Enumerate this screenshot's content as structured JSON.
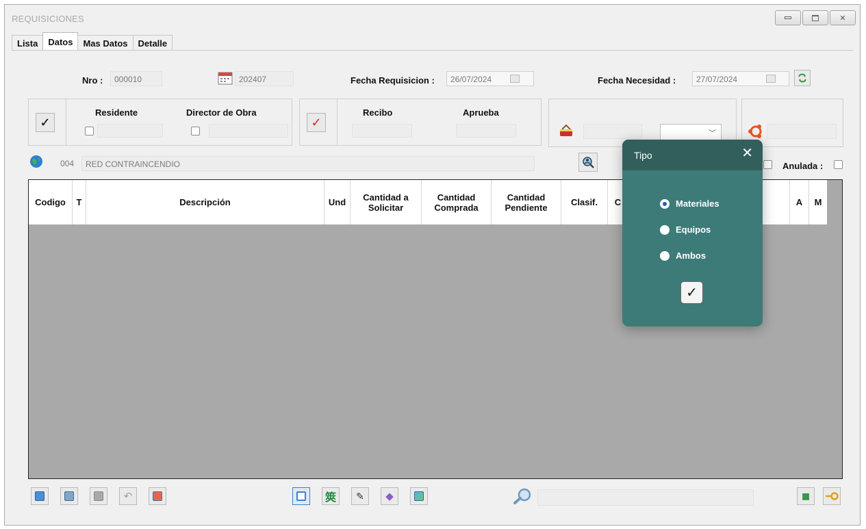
{
  "window": {
    "title": "REQUISICIONES",
    "controls": [
      "minimize",
      "maximize",
      "close"
    ]
  },
  "tabs": [
    {
      "label": "Lista",
      "active": false
    },
    {
      "label": "Datos",
      "active": true
    },
    {
      "label": "Mas Datos",
      "active": false
    },
    {
      "label": "Detalle",
      "active": false
    }
  ],
  "header": {
    "nro_label": "Nro :",
    "nro_value": "000010",
    "period_value": "202407",
    "fecha_requisicion_label": "Fecha Requisicion :",
    "fecha_requisicion_value": "26/07/2024",
    "fecha_necesidad_label": "Fecha Necesidad :",
    "fecha_necesidad_value": "27/07/2024"
  },
  "approvals": {
    "residente_label": "Residente",
    "director_label": "Director de Obra",
    "recibo_label": "Recibo",
    "aprueba_label": "Aprueba"
  },
  "project": {
    "code": "004",
    "name": "RED CONTRAINCENDIO",
    "anulada_label": "Anulada :"
  },
  "grid": {
    "columns": [
      "Codigo",
      "T",
      "Descripción",
      "Und",
      "Cantidad a Solicitar",
      "Cantidad Comprada",
      "Cantidad Pendiente",
      "Clasif.",
      "C",
      "",
      "A",
      "M"
    ],
    "rows": []
  },
  "dialog": {
    "title": "Tipo",
    "options": [
      {
        "label": "Materiales",
        "selected": true
      },
      {
        "label": "Equipos",
        "selected": false
      },
      {
        "label": "Ambos",
        "selected": false
      }
    ]
  },
  "colors": {
    "dialog_bg": "#3d7b78",
    "dialog_header": "#325f5b",
    "grid_bg": "#a9a9a9",
    "window_bg": "#f0f0f0"
  }
}
